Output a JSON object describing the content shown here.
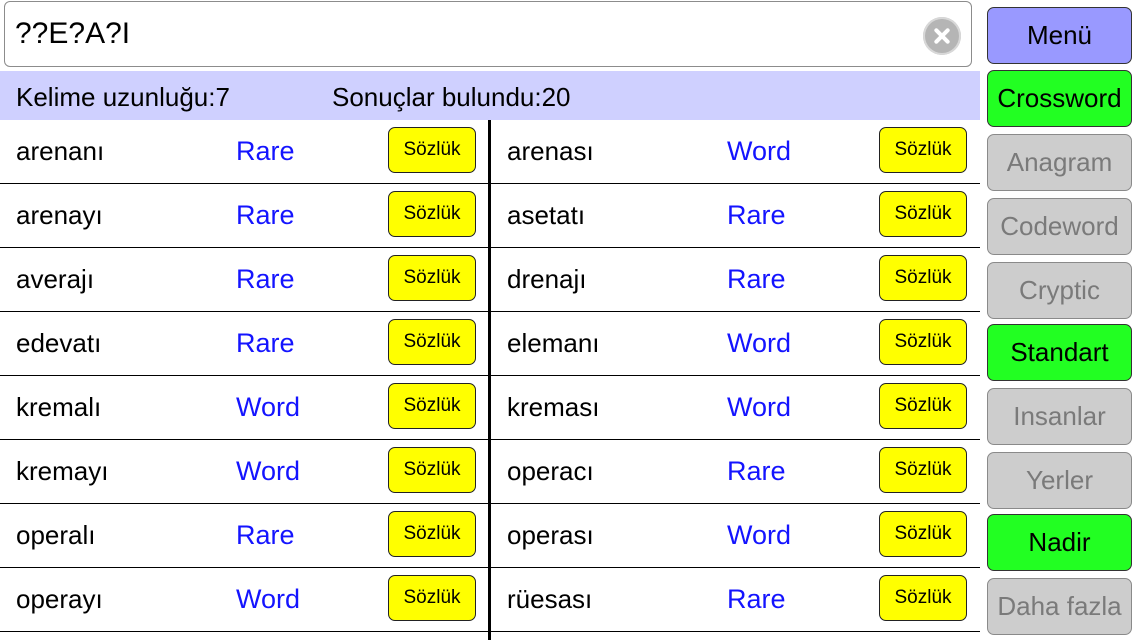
{
  "search": {
    "value": "??E?A?I"
  },
  "info": {
    "length_text": "Kelime uzunluğu:7",
    "results_text": "Sonuçlar bulundu:20"
  },
  "dict_label": "Sözlük",
  "results_left": [
    {
      "word": "arenanı",
      "type": "Rare"
    },
    {
      "word": "arenayı",
      "type": "Rare"
    },
    {
      "word": "averajı",
      "type": "Rare"
    },
    {
      "word": "edevatı",
      "type": "Rare"
    },
    {
      "word": "kremalı",
      "type": "Word"
    },
    {
      "word": "kremayı",
      "type": "Word"
    },
    {
      "word": "operalı",
      "type": "Rare"
    },
    {
      "word": "operayı",
      "type": "Word"
    }
  ],
  "results_right": [
    {
      "word": "arenası",
      "type": "Word"
    },
    {
      "word": "asetatı",
      "type": "Rare"
    },
    {
      "word": "drenajı",
      "type": "Rare"
    },
    {
      "word": "elemanı",
      "type": "Word"
    },
    {
      "word": "kreması",
      "type": "Word"
    },
    {
      "word": "operacı",
      "type": "Rare"
    },
    {
      "word": "operası",
      "type": "Word"
    },
    {
      "word": "rüesası",
      "type": "Rare"
    }
  ],
  "sidebar": [
    {
      "label": "Menü",
      "style": "menu"
    },
    {
      "label": "Crossword",
      "style": "green"
    },
    {
      "label": "Anagram",
      "style": "gray"
    },
    {
      "label": "Codeword",
      "style": "gray"
    },
    {
      "label": "Cryptic",
      "style": "gray"
    },
    {
      "label": "Standart",
      "style": "green"
    },
    {
      "label": "Insanlar",
      "style": "gray"
    },
    {
      "label": "Yerler",
      "style": "gray"
    },
    {
      "label": "Nadir",
      "style": "green"
    },
    {
      "label": "Daha fazla",
      "style": "gray"
    }
  ],
  "colors": {
    "info_bar": "#cfd0ff",
    "type_text": "#1414ff",
    "dict_button": "#ffff00",
    "active": "#22ff22",
    "menu": "#9999ff",
    "inactive": "#cdcdcd"
  }
}
